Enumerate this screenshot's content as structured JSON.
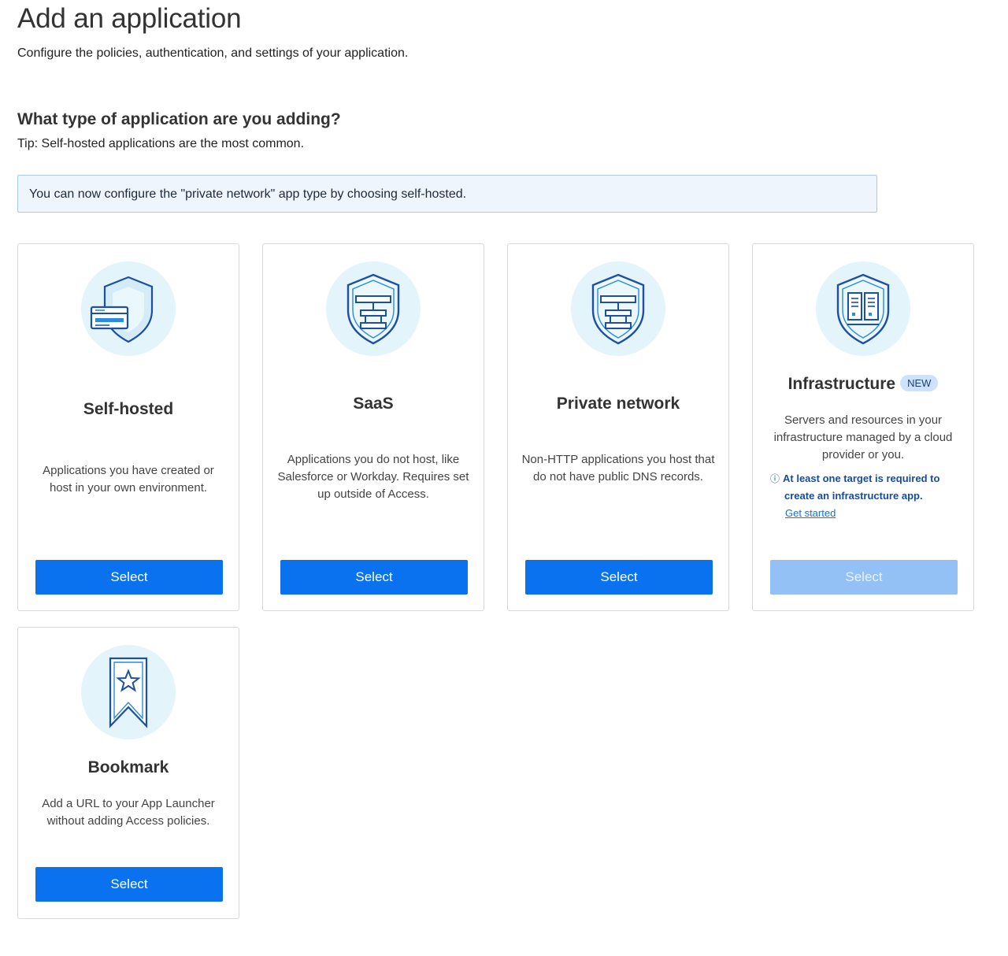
{
  "header": {
    "title": "Add an application",
    "subtitle": "Configure the policies, authentication, and settings of your application."
  },
  "section": {
    "title": "What type of application are you adding?",
    "tip": "Tip: Self-hosted applications are the most common."
  },
  "banner": {
    "text": "You can now configure the \"private network\" app type by choosing self-hosted."
  },
  "cards": [
    {
      "title": "Self-hosted",
      "description": "Applications you have created or host in your own environment.",
      "button": "Select",
      "icon": "browser-shield-icon"
    },
    {
      "title": "SaaS",
      "description": "Applications you do not host, like Salesforce or Workday. Requires set up outside of Access.",
      "button": "Select",
      "icon": "network-shield-icon"
    },
    {
      "title": "Private network",
      "description": "Non-HTTP applications you host that do not have public DNS records.",
      "button": "Select",
      "icon": "network-shield-icon"
    },
    {
      "title": "Infrastructure",
      "badge": "NEW",
      "description": "Servers and resources in your infrastructure managed by a cloud provider or you.",
      "notice_line1": "At least one target is required to",
      "notice_line2": "create an infrastructure app.",
      "link": "Get started",
      "button": "Select",
      "button_disabled": true,
      "icon": "server-shield-icon"
    },
    {
      "title": "Bookmark",
      "description": "Add a URL to your App Launcher without adding Access policies.",
      "button": "Select",
      "icon": "bookmark-star-icon"
    }
  ],
  "colors": {
    "primary_button": "#0a72ef",
    "disabled_button": "#93c1f5",
    "icon_circle": "#e3f4fb",
    "icon_stroke": "#1d4fa3",
    "banner_bg": "#eef5fd",
    "banner_border": "#a9c8ee"
  }
}
